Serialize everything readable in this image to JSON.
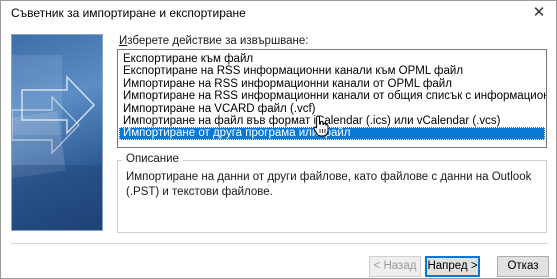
{
  "window": {
    "title": "Съветник за импортиране и експортиране"
  },
  "title_bar": {
    "close_icon": "close-icon",
    "close_glyph": "✕"
  },
  "prompt": {
    "label_acc": "И",
    "label_rest": "зберете действие за извършване:"
  },
  "actions": [
    {
      "label": "Експортиране към файл",
      "selected": false
    },
    {
      "label": "Експортиране на RSS информационни канали към OPML файл",
      "selected": false
    },
    {
      "label": "Импортиране на RSS информационни канали от OPML файл",
      "selected": false
    },
    {
      "label": "Импортиране на RSS информационни канали от общия списък с информационни канали",
      "selected": false
    },
    {
      "label": "Импортиране на VCARD файл (.vcf)",
      "selected": false
    },
    {
      "label": "Импортиране на файл във формат iCalendar (.ics) или vCalendar (.vcs)",
      "selected": false
    },
    {
      "label": "Импортиране от друга програма или файл",
      "selected": true
    }
  ],
  "description": {
    "legend": "Описание",
    "text": "Импортиране на данни от други файлове, като файлове с данни на Outlook (.PST) и текстови файлове."
  },
  "buttons": {
    "back": "< Назад",
    "next": "Напред >",
    "cancel": "Отказ"
  },
  "colors": {
    "selection": "#0a78d7",
    "art_panel": "#3f6ea8"
  }
}
